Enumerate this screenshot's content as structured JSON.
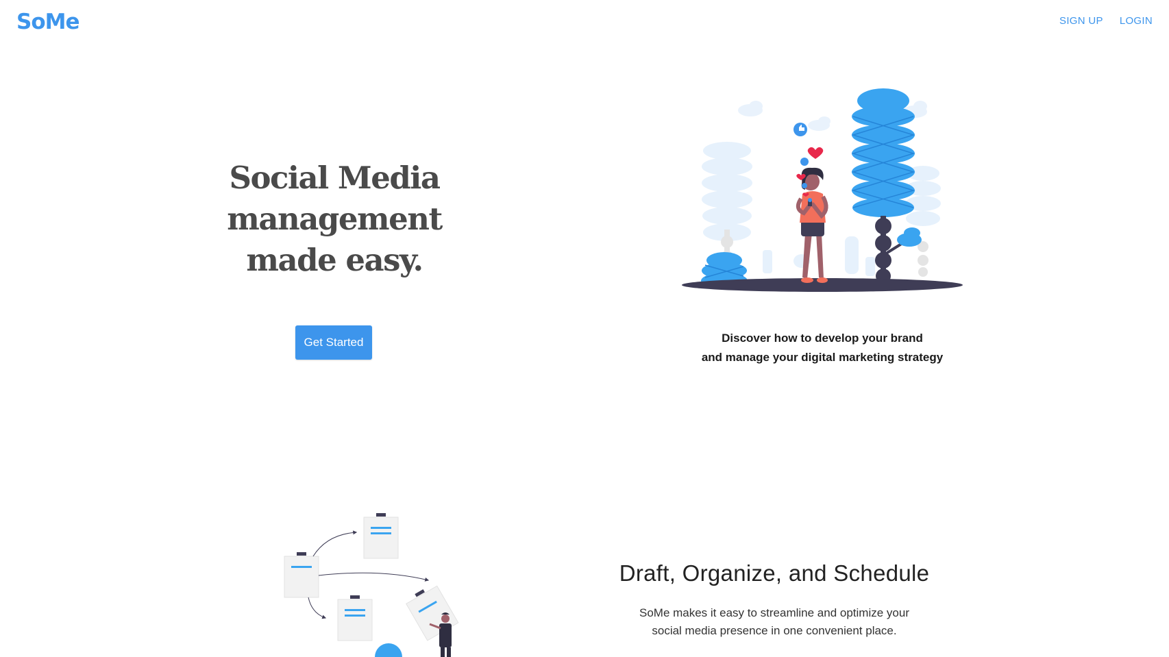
{
  "header": {
    "logo": "SoMe",
    "nav": {
      "signup": "SIGN UP",
      "login": "LOGIN"
    }
  },
  "hero": {
    "title_lines": [
      "Social Media",
      "management",
      "made easy."
    ],
    "cta": "Get Started",
    "subtitle_lines": [
      "Discover how to develop your brand",
      "and manage your digital marketing strategy"
    ]
  },
  "feature": {
    "title": "Draft, Organize, and Schedule",
    "desc_lines": [
      "SoMe makes it easy to streamline and optimize your",
      "social media presence in one convenient place."
    ]
  },
  "colors": {
    "brand": "#3d95ec",
    "heading": "#4a4a4a",
    "accent_red": "#e8284b",
    "figure_shirt": "#f26f5b",
    "ground": "#3f3d56"
  }
}
